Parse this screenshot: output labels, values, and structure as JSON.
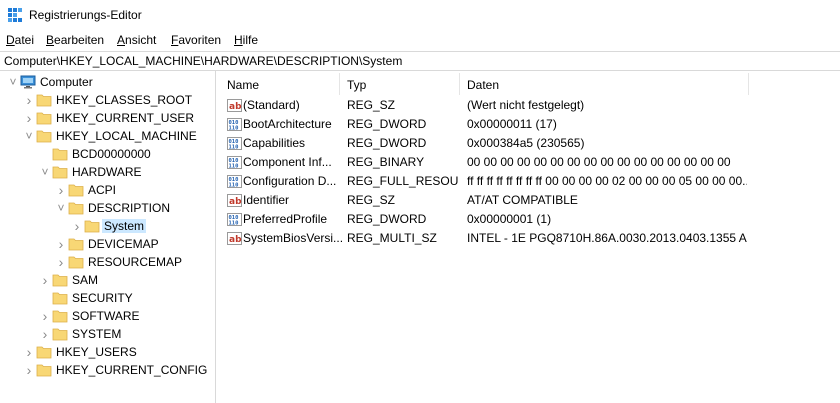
{
  "window": {
    "title": "Registrierungs-Editor"
  },
  "menu": [
    {
      "label": "Datei",
      "ul": "D",
      "rest": "atei"
    },
    {
      "label": "Bearbeiten",
      "ul": "B",
      "rest": "earbeiten"
    },
    {
      "label": "Ansicht",
      "ul": "A",
      "rest": "nsicht"
    },
    {
      "label": "Favoriten",
      "ul": "F",
      "rest": "avoriten"
    },
    {
      "label": "Hilfe",
      "ul": "H",
      "rest": "ilfe"
    }
  ],
  "address": "Computer\\HKEY_LOCAL_MACHINE\\HARDWARE\\DESCRIPTION\\System",
  "tree": [
    {
      "label": "Computer",
      "level": 0,
      "exp": "open",
      "kind": "computer"
    },
    {
      "label": "HKEY_CLASSES_ROOT",
      "level": 1,
      "exp": "closed"
    },
    {
      "label": "HKEY_CURRENT_USER",
      "level": 1,
      "exp": "closed"
    },
    {
      "label": "HKEY_LOCAL_MACHINE",
      "level": 1,
      "exp": "open"
    },
    {
      "label": "BCD00000000",
      "level": 2,
      "exp": "none"
    },
    {
      "label": "HARDWARE",
      "level": 2,
      "exp": "open"
    },
    {
      "label": "ACPI",
      "level": 3,
      "exp": "closed"
    },
    {
      "label": "DESCRIPTION",
      "level": 3,
      "exp": "open"
    },
    {
      "label": "System",
      "level": 4,
      "exp": "closed",
      "selected": true
    },
    {
      "label": "DEVICEMAP",
      "level": 3,
      "exp": "closed"
    },
    {
      "label": "RESOURCEMAP",
      "level": 3,
      "exp": "closed"
    },
    {
      "label": "SAM",
      "level": 2,
      "exp": "closed"
    },
    {
      "label": "SECURITY",
      "level": 2,
      "exp": "none"
    },
    {
      "label": "SOFTWARE",
      "level": 2,
      "exp": "closed"
    },
    {
      "label": "SYSTEM",
      "level": 2,
      "exp": "closed"
    },
    {
      "label": "HKEY_USERS",
      "level": 1,
      "exp": "closed"
    },
    {
      "label": "HKEY_CURRENT_CONFIG",
      "level": 1,
      "exp": "closed"
    }
  ],
  "columns": {
    "name": "Name",
    "type": "Typ",
    "data": "Daten"
  },
  "values": [
    {
      "icon": "string",
      "name": "(Standard)",
      "type": "REG_SZ",
      "data": "(Wert nicht festgelegt)"
    },
    {
      "icon": "binary",
      "name": "BootArchitecture",
      "type": "REG_DWORD",
      "data": "0x00000011 (17)"
    },
    {
      "icon": "binary",
      "name": "Capabilities",
      "type": "REG_DWORD",
      "data": "0x000384a5 (230565)"
    },
    {
      "icon": "binary",
      "name": "Component Inf...",
      "type": "REG_BINARY",
      "data": "00 00 00 00 00 00 00 00 00 00 00 00 00 00 00 00"
    },
    {
      "icon": "binary",
      "name": "Configuration D...",
      "type": "REG_FULL_RESOU...",
      "data": "ff ff ff ff ff ff ff ff 00 00 00 00 02 00 00 00 05 00 00 00..."
    },
    {
      "icon": "string",
      "name": "Identifier",
      "type": "REG_SZ",
      "data": "AT/AT COMPATIBLE"
    },
    {
      "icon": "binary",
      "name": "PreferredProfile",
      "type": "REG_DWORD",
      "data": "0x00000001 (1)"
    },
    {
      "icon": "string",
      "name": "SystemBiosVersi...",
      "type": "REG_MULTI_SZ",
      "data": "INTEL  - 1E PGQ8710H.86A.0030.2013.0403.1355 A..."
    }
  ]
}
